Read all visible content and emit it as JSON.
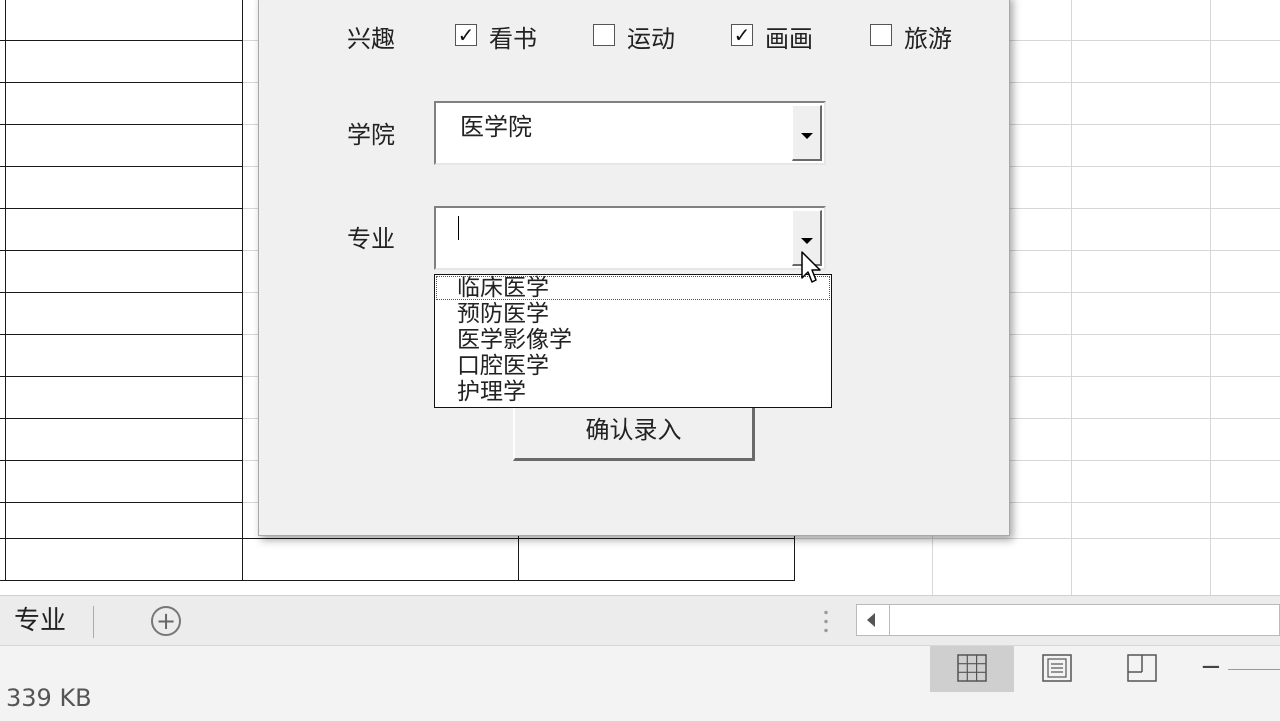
{
  "dialog": {
    "interest_label": "兴趣",
    "interests": [
      {
        "label": "看书",
        "checked": true
      },
      {
        "label": "运动",
        "checked": false
      },
      {
        "label": "画画",
        "checked": true
      },
      {
        "label": "旅游",
        "checked": false
      }
    ],
    "college_label": "学院",
    "college_value": "医学院",
    "major_label": "专业",
    "major_value": "",
    "major_options": [
      "临床医学",
      "预防医学",
      "医学影像学",
      "口腔医学",
      "护理学"
    ],
    "confirm_label": "确认录入",
    "check_glyph": "✓"
  },
  "tabbar": {
    "sheet_name": "专业",
    "add_symbol": "+"
  },
  "status": {
    "file_size": "339 KB",
    "zoom_minus": "−"
  }
}
